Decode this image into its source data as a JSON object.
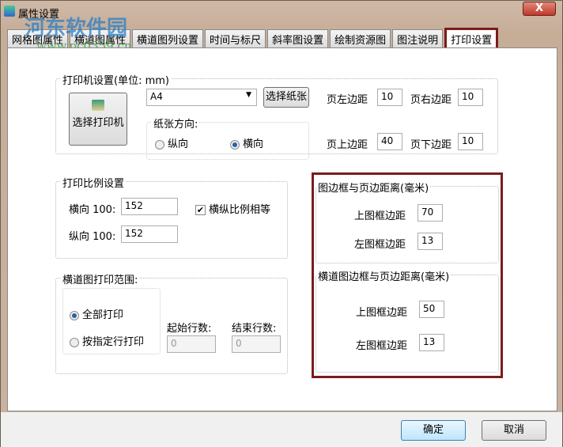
{
  "window": {
    "title": "属性设置",
    "close": "X"
  },
  "watermark": {
    "name": "河东软件园",
    "url": "www.pc0359.cn"
  },
  "tabs": [
    "网格图属性",
    "横道图属性",
    "横道图列设置",
    "时间与标尺",
    "斜率图设置",
    "绘制资源图",
    "图注说明",
    "打印设置"
  ],
  "printer": {
    "group": "打印机设置(单位: mm)",
    "select_printer": "选择打印机",
    "paper": "A4",
    "select_paper": "选择纸张",
    "orientation_group": "纸张方向:",
    "portrait": "纵向",
    "landscape": "横向",
    "orientation_selected": "landscape",
    "left_margin_label": "页左边距",
    "left_margin": "10",
    "right_margin_label": "页右边距",
    "right_margin": "10",
    "top_margin_label": "页上边距",
    "top_margin": "40",
    "bottom_margin_label": "页下边距",
    "bottom_margin": "10"
  },
  "scale": {
    "group": "打印比例设置",
    "h_label": "横向 100:",
    "h_value": "152",
    "v_label": "纵向 100:",
    "v_value": "152",
    "equal_label": "横纵比例相等",
    "equal_checked": true
  },
  "range": {
    "group": "横道图打印范围:",
    "all": "全部打印",
    "specified": "按指定行打印",
    "selected": "all",
    "start_label": "起始行数:",
    "start": "0",
    "end_label": "结束行数:",
    "end": "0"
  },
  "frame1": {
    "group": "图边框与页边距离(毫米)",
    "top_label": "上图框边距",
    "top": "70",
    "left_label": "左图框边距",
    "left": "13"
  },
  "frame2": {
    "group": "横道图边框与页边距离(毫米)",
    "top_label": "上图框边距",
    "top": "50",
    "left_label": "左图框边距",
    "left": "13"
  },
  "footer": {
    "ok": "确定",
    "cancel": "取消"
  }
}
